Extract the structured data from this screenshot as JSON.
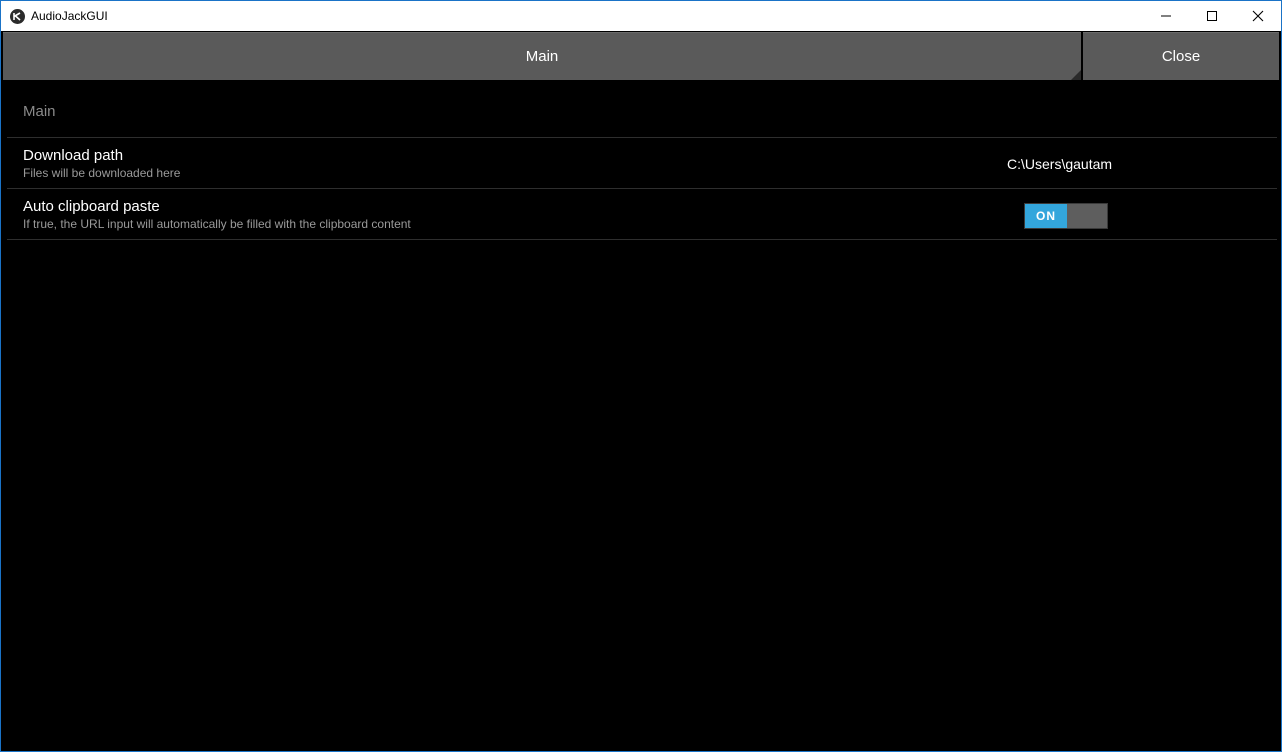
{
  "window": {
    "title": "AudioJackGUI",
    "icon": "kivy-logo-icon"
  },
  "tabs": {
    "main_label": "Main",
    "close_label": "Close"
  },
  "settings": {
    "section_title": "Main",
    "items": [
      {
        "title": "Download path",
        "description": "Files will be downloaded here",
        "value": "C:\\Users\\gautam"
      },
      {
        "title": "Auto clipboard paste",
        "description": "If true, the URL input will automatically be filled with the clipboard content",
        "switch_label": "ON",
        "switch_state": true
      }
    ]
  },
  "colors": {
    "accent": "#33a6dc",
    "tab_bg": "#5a5a5a",
    "background": "#000000"
  }
}
